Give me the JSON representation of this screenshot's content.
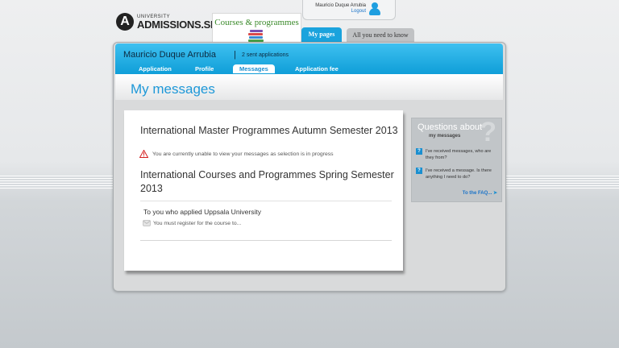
{
  "logo": {
    "mark": "A",
    "small": "UNIVERSITY",
    "big": "ADMISSIONS.SE"
  },
  "top_tabs": {
    "courses": "Courses & programmes",
    "my_pages": "My pages",
    "all_you_need": "All you need to know"
  },
  "user": {
    "name": "Mauricio Duque Arrubia",
    "logout": "Logout"
  },
  "header": {
    "user_name": "Mauricio Duque Arrubia",
    "separator": "|",
    "sent": "2 sent applications"
  },
  "nav": [
    {
      "label": "Application",
      "active": false
    },
    {
      "label": "Profile",
      "active": false
    },
    {
      "label": "Messages",
      "active": true
    },
    {
      "label": "Application fee",
      "active": false
    }
  ],
  "page_title": "My messages",
  "messages": {
    "group1_title": "International Master Programmes Autumn Semester 2013",
    "group1_warning": "You are currently unable to view your messages as selection is in progress",
    "group2_title": "International Courses and Programmes Spring Semester 2013",
    "to_you": "To you who applied Uppsala University",
    "message_preview": "You must register for the course to..."
  },
  "faq": {
    "qmark": "?",
    "title": "Questions about",
    "subtitle": "my messages",
    "items": [
      "I've received messages, who are they from?",
      "I've received a message. Is there anything I need to do?"
    ],
    "item_icon": "?",
    "link": "To the FAQ..."
  },
  "colors": {
    "accent": "#1aa3dd",
    "title_blue": "#1e98d8",
    "green": "#3a8a2a",
    "warning": "#d42020"
  },
  "icons": [
    "logo-icon",
    "books-icon",
    "user-icon",
    "warning-icon",
    "envelope-icon",
    "help-icon",
    "arrow-right-icon"
  ]
}
